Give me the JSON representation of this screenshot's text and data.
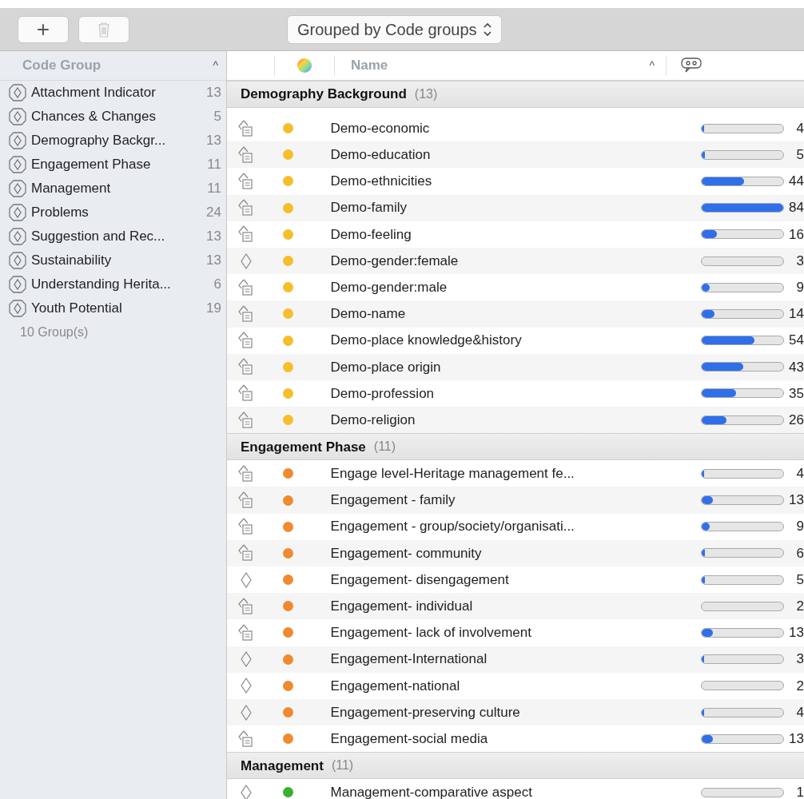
{
  "toolbar": {
    "add_button": "+",
    "group_by": "Grouped by Code groups"
  },
  "sidebar": {
    "header": "Code Group",
    "sort_icon": "^",
    "footer": "10 Group(s)",
    "items": [
      {
        "name": "Attachment Indicator",
        "count": "13"
      },
      {
        "name": "Chances & Changes",
        "count": "5"
      },
      {
        "name": "Demography Backgr...",
        "count": "13"
      },
      {
        "name": "Engagement Phase",
        "count": "11"
      },
      {
        "name": "Management",
        "count": "11"
      },
      {
        "name": "Problems",
        "count": "24"
      },
      {
        "name": "Suggestion and Rec...",
        "count": "13"
      },
      {
        "name": "Sustainability",
        "count": "13"
      },
      {
        "name": "Understanding Herita...",
        "count": "6"
      },
      {
        "name": "Youth Potential",
        "count": "19"
      }
    ]
  },
  "table": {
    "columns": {
      "name": "Name",
      "sort_icon": "^"
    },
    "groups": [
      {
        "title": "Demography Background",
        "count": "(13)",
        "color": "#f4bf2a",
        "rows": [
          {
            "kind": "memo",
            "name": "Demo-economic",
            "level": 0.03,
            "count": "4"
          },
          {
            "kind": "memo",
            "name": "Demo-education",
            "level": 0.04,
            "count": "5"
          },
          {
            "kind": "memo",
            "name": "Demo-ethnicities",
            "level": 0.52,
            "count": "44"
          },
          {
            "kind": "memo",
            "name": "Demo-family",
            "level": 1,
            "count": "84"
          },
          {
            "kind": "memo",
            "name": "Demo-feeling",
            "level": 0.19,
            "count": "16"
          },
          {
            "kind": "plain",
            "name": "Demo-gender:female",
            "level": 0,
            "count": "3"
          },
          {
            "kind": "memo",
            "name": "Demo-gender:male",
            "level": 0.1,
            "count": "9"
          },
          {
            "kind": "memo",
            "name": "Demo-name",
            "level": 0.16,
            "count": "14"
          },
          {
            "kind": "memo",
            "name": "Demo-place knowledge&history",
            "level": 0.65,
            "count": "54"
          },
          {
            "kind": "memo",
            "name": "Demo-place origin",
            "level": 0.51,
            "count": "43"
          },
          {
            "kind": "memo",
            "name": "Demo-profession",
            "level": 0.42,
            "count": "35"
          },
          {
            "kind": "memo",
            "name": "Demo-religion",
            "level": 0.31,
            "count": "26"
          }
        ]
      },
      {
        "title": "Engagement Phase",
        "count": "(11)",
        "color": "#ef8a2e",
        "rows": [
          {
            "kind": "memo",
            "name": "Engage level-Heritage management fe...",
            "level": 0.03,
            "count": "4"
          },
          {
            "kind": "memo",
            "name": "Engagement - family",
            "level": 0.14,
            "count": "13"
          },
          {
            "kind": "memo",
            "name": "Engagement - group/society/organisati...",
            "level": 0.1,
            "count": "9"
          },
          {
            "kind": "memo",
            "name": "Engagement- community",
            "level": 0.04,
            "count": "6"
          },
          {
            "kind": "plain",
            "name": "Engagement- disengagement",
            "level": 0.04,
            "count": "5"
          },
          {
            "kind": "memo",
            "name": "Engagement- individual",
            "level": 0,
            "count": "2"
          },
          {
            "kind": "memo",
            "name": "Engagement- lack of involvement",
            "level": 0.14,
            "count": "13"
          },
          {
            "kind": "plain",
            "name": "Engagement-International",
            "level": 0.02,
            "count": "3"
          },
          {
            "kind": "plain",
            "name": "Engagement-national",
            "level": 0,
            "count": "2"
          },
          {
            "kind": "plain",
            "name": "Engagement-preserving culture",
            "level": 0.03,
            "count": "4"
          },
          {
            "kind": "memo",
            "name": "Engagement-social media",
            "level": 0.14,
            "count": "13"
          }
        ]
      },
      {
        "title": "Management",
        "count": "(11)",
        "color": "#3cae2f",
        "rows": [
          {
            "kind": "plain",
            "name": "Management-comparative aspect",
            "level": 0,
            "count": "1"
          }
        ]
      }
    ]
  }
}
